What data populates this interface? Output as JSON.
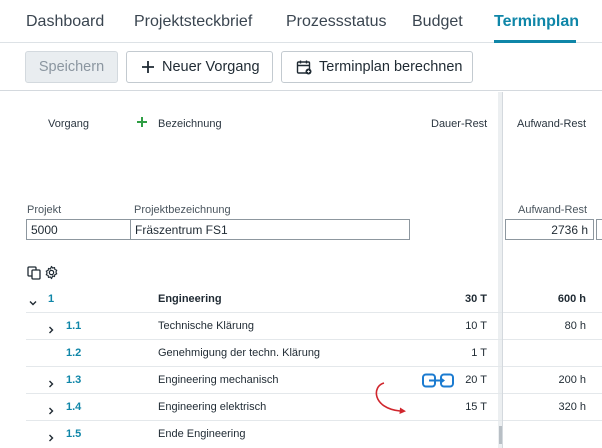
{
  "tabs": [
    {
      "label": "Dashboard",
      "active": false
    },
    {
      "label": "Projektsteckbrief",
      "active": false
    },
    {
      "label": "Prozessstatus",
      "active": false
    },
    {
      "label": "Budget",
      "active": false
    },
    {
      "label": "Terminplan",
      "active": true
    }
  ],
  "toolbar": {
    "save_label": "Speichern",
    "new_task_label": "Neuer Vorgang",
    "calc_label": "Terminplan berechnen"
  },
  "grid_header": {
    "vorgang": "Vorgang",
    "bezeichnung": "Bezeichnung",
    "dauer_rest": "Dauer-Rest",
    "aufwand_rest": "Aufwand-Rest"
  },
  "project": {
    "projekt_label": "Projekt",
    "projekt_value": "5000",
    "bezeichnung_label": "Projektbezeichnung",
    "bezeichnung_value": "Fräszentrum FS1",
    "aufwand_label": "Aufwand-Rest",
    "aufwand_value": "2736 h"
  },
  "rows": [
    {
      "id": "1",
      "name": "Engineering",
      "dauer": "30 T",
      "aufwand": "600 h"
    },
    {
      "id": "1.1",
      "name": "Technische Klärung",
      "dauer": "10 T",
      "aufwand": "80 h"
    },
    {
      "id": "1.2",
      "name": "Genehmigung der techn. Klärung",
      "dauer": "1 T",
      "aufwand": ""
    },
    {
      "id": "1.3",
      "name": "Engineering mechanisch",
      "dauer": "20 T",
      "aufwand": "200 h"
    },
    {
      "id": "1.4",
      "name": "Engineering elektrisch",
      "dauer": "15 T",
      "aufwand": "320 h"
    },
    {
      "id": "1.5",
      "name": "Ende Engineering",
      "dauer": "",
      "aufwand": ""
    }
  ],
  "colors": {
    "accent": "#0f86a8",
    "green": "#2f9e44",
    "link_icon": "#1b7bd0",
    "arrow": "#d0262d"
  }
}
